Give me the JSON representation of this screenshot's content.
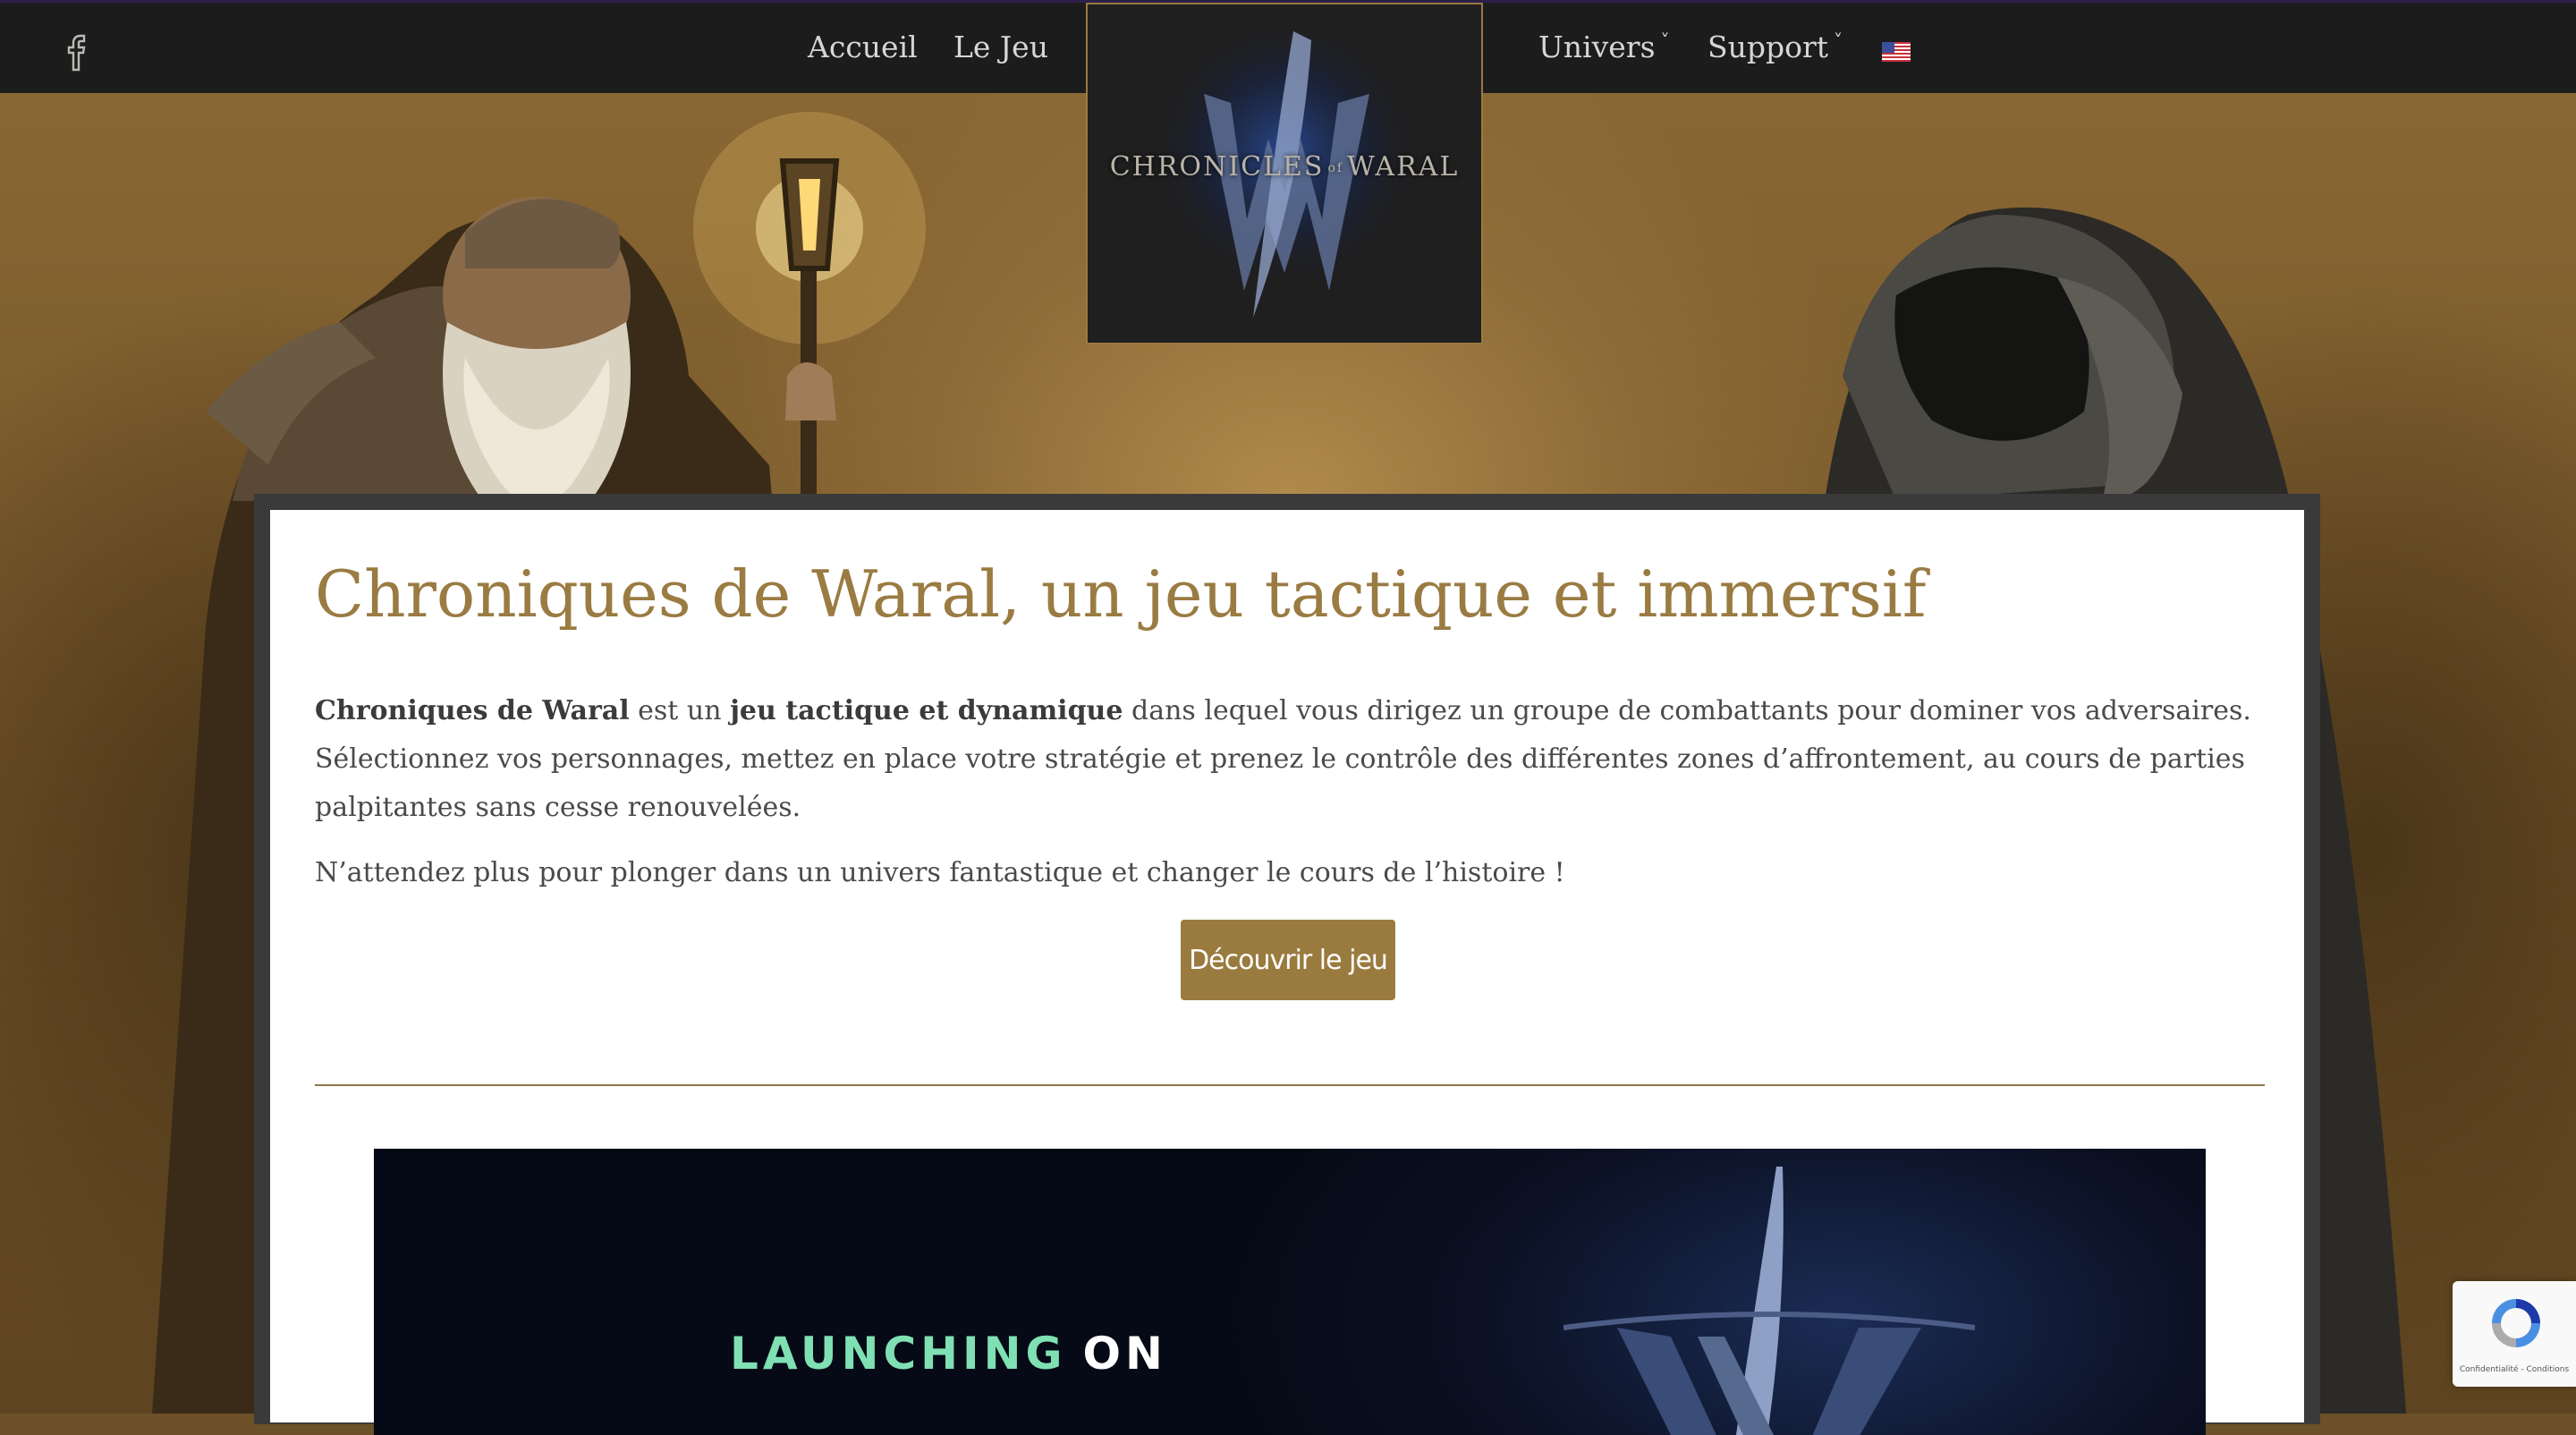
{
  "nav": {
    "home": "Accueil",
    "game": "Le Jeu",
    "universe": "Univers",
    "support": "Support",
    "caret": "˅"
  },
  "logo": {
    "text_left": "CHRONICLES",
    "text_of": "of",
    "text_right": "WARAL"
  },
  "main": {
    "title": "Chroniques de Waral, un jeu tactique et immersif",
    "intro_bold_1": "Chroniques de Waral",
    "intro_text_1": " est un ",
    "intro_bold_2": "jeu tactique et dynamique",
    "intro_text_2": " dans lequel vous dirigez un groupe de combattants pour dominer vos adversaires. Sélectionnez vos personnages, mettez en place votre stratégie et prenez le contrôle des différentes zones d’affrontement, au cours de parties palpitantes sans cesse renouvelées.",
    "tagline": "N’attendez plus pour plonger dans un univers fantastique et changer le cours de l’histoire !",
    "cta_label": "Découvrir le jeu"
  },
  "banner": {
    "launch_word_1": "LAUNCHING",
    "launch_word_2": "ON"
  },
  "recaptcha": {
    "links": "Confidentialité - Conditions"
  },
  "colors": {
    "accent_gold": "#9a7b42",
    "nav_bg": "#1c1c1d",
    "banner_green": "#7fe0b3"
  },
  "icons": {
    "social": "facebook-icon",
    "language": "us-flag-icon"
  }
}
